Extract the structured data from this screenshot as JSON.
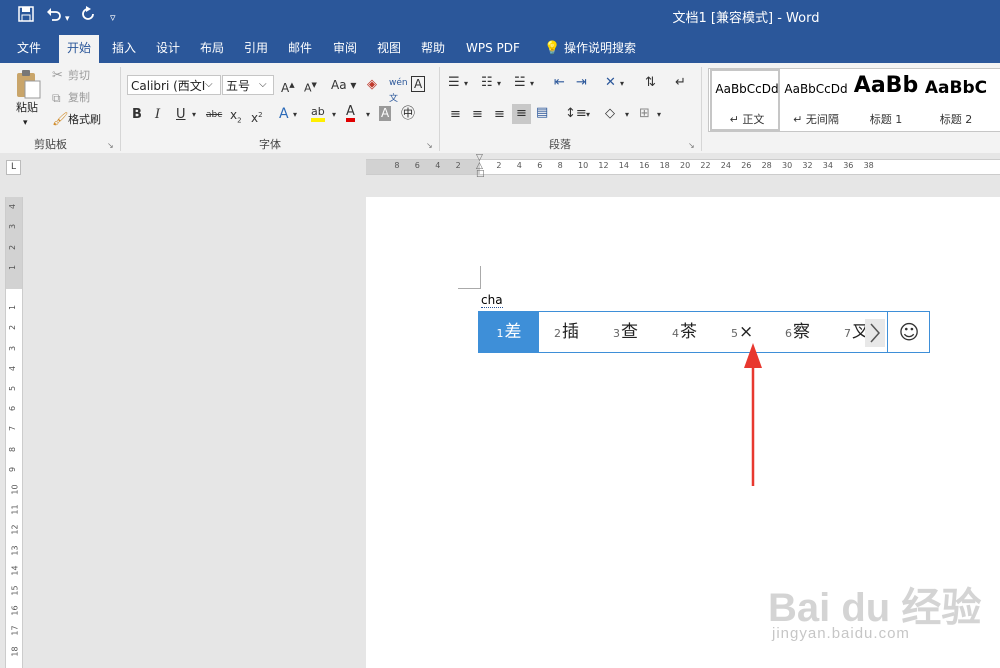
{
  "titlebar": {
    "title": "文档1 [兼容模式]  -  Word",
    "save_icon": "save-icon",
    "undo_icon": "undo-icon",
    "redo_icon": "redo-icon",
    "customize_icon": "customize-qat-icon",
    "bg_color": "#2b579a"
  },
  "tabs": [
    "文件",
    "开始",
    "插入",
    "设计",
    "布局",
    "引用",
    "邮件",
    "审阅",
    "视图",
    "帮助",
    "WPS PDF"
  ],
  "active_tab": "开始",
  "tell_me": "操作说明搜索",
  "clipboard": {
    "paste": "粘贴",
    "cut": "剪切",
    "copy": "复制",
    "format_painter": "格式刷",
    "group_label": "剪贴板"
  },
  "font": {
    "font_name": "Calibri (西文I",
    "font_size": "五号",
    "group_label": "字体",
    "change_case": "Aa",
    "strike_label": "abc"
  },
  "paragraph": {
    "group_label": "段落"
  },
  "styles": [
    {
      "sample": "AaBbCcDd",
      "name": "↵ 正文"
    },
    {
      "sample": "AaBbCcDd",
      "name": "↵ 无间隔"
    },
    {
      "sample": "AaBb",
      "name": "标题 1"
    },
    {
      "sample": "AaBbC",
      "name": "标题 2"
    }
  ],
  "ruler": {
    "h_labels": [
      "8",
      "6",
      "4",
      "2",
      "2",
      "4",
      "6",
      "8",
      "10",
      "12",
      "14",
      "16",
      "18",
      "20",
      "22",
      "24",
      "26",
      "28",
      "30",
      "32",
      "34",
      "36",
      "38"
    ],
    "v_labels": [
      "4",
      "3",
      "2",
      "1",
      "1",
      "2",
      "3",
      "4",
      "5",
      "6",
      "7",
      "8",
      "9",
      "10",
      "11",
      "12",
      "13",
      "14",
      "15",
      "16",
      "17",
      "18"
    ]
  },
  "document": {
    "composition_text": "cha"
  },
  "ime": {
    "candidates": [
      {
        "num": "1",
        "text": "差"
      },
      {
        "num": "2",
        "text": "插"
      },
      {
        "num": "3",
        "text": "查"
      },
      {
        "num": "4",
        "text": "茶"
      },
      {
        "num": "5",
        "text": "×"
      },
      {
        "num": "6",
        "text": "察"
      },
      {
        "num": "7",
        "text": "叉"
      }
    ],
    "selected_index": 0,
    "accent_color": "#3e8fd8",
    "next_icon": "chevron-right-icon",
    "emoji_icon": "smiley-icon"
  },
  "annotation": {
    "arrow_color": "#e8382f"
  },
  "watermark": {
    "brand": "Bai du 经验",
    "url": "jingyan.baidu.com"
  }
}
